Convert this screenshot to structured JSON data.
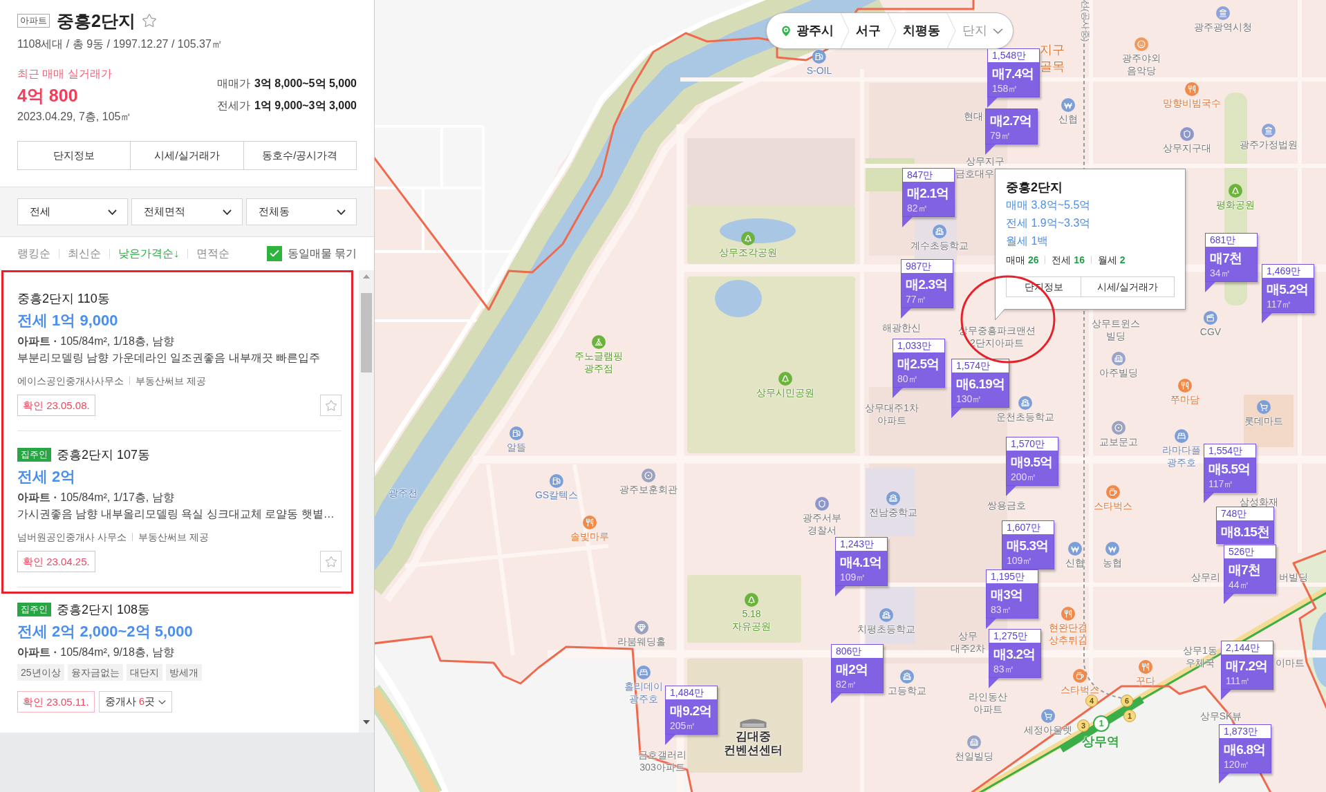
{
  "complex": {
    "type_badge": "아파트",
    "name": "중흥2단지",
    "favorite": false,
    "summary": "1108세대 / 총 9동 / 1997.12.27 / 105.37㎡"
  },
  "recent_trade": {
    "label": "최근 매매 실거래가",
    "price": "4억 800",
    "detail": "2023.04.29, 7층, 105㎡"
  },
  "price_ranges": [
    {
      "label": "매매가",
      "value": "3억 8,000~5억 5,000"
    },
    {
      "label": "전세가",
      "value": "1억 9,000~3억 3,000"
    }
  ],
  "info_tabs": [
    "단지정보",
    "시세/실거래가",
    "동호수/공시가격"
  ],
  "filters": [
    "전세",
    "전체면적",
    "전체동"
  ],
  "sort_options": [
    {
      "label": "랭킹순",
      "selected": false
    },
    {
      "label": "최신순",
      "selected": false
    },
    {
      "label": "낮은가격순↓",
      "selected": true
    },
    {
      "label": "면적순",
      "selected": false
    }
  ],
  "group_same": {
    "label": "동일매물 묶기",
    "checked": true
  },
  "listings": [
    {
      "title": "중흥2단지 110동",
      "price": "전세 1억 9,000",
      "detail": "**아파트 ·** 105/84m², 1/18층, 남향",
      "description": "부분리모델링 남향 가운데라인 일조권좋음 내부깨끗 빠른입주",
      "agency": "에이스공인중개사사무소",
      "provider": "부동산써브 제공",
      "confirmed": "확인 23.05.08.",
      "favorite": false
    },
    {
      "owner_badge": "집주인",
      "title": "중흥2단지 107동",
      "price": "전세 2억",
      "detail": "**아파트 ·** 105/84m², 1/17층, 남향",
      "description": "가시권좋음 남향 내부올리모델링 욕실 싱크대교체 로얄동 햇볕…",
      "agency": "넘버원공인중개사 사무소",
      "provider": "부동산써브 제공",
      "confirmed": "확인 23.04.25.",
      "favorite": false
    },
    {
      "owner_badge": "집주인",
      "title": "중흥2단지 108동",
      "price": "전세 2억 2,000~2억 5,000",
      "detail": "**아파트 ·** 105/84m², 9/18층, 남향",
      "tags": [
        "25년이상",
        "융자금없는",
        "대단지",
        "방세개"
      ],
      "confirmed": "확인 23.05.11.",
      "agents": {
        "label": "중개사",
        "count": "6",
        "unit": "곳"
      }
    }
  ],
  "highlights": [
    {
      "kind": "frame"
    },
    {
      "kind": "circle"
    }
  ],
  "map": {
    "location_bar": [
      {
        "label": "광주시",
        "kind": "location"
      },
      {
        "label": "서구",
        "kind": "area"
      },
      {
        "label": "치평동",
        "kind": "area"
      },
      {
        "label": "단지",
        "kind": "dropdown"
      }
    ],
    "places": [
      {
        "lines": [
          "S-OIL"
        ],
        "kind": "gas"
      },
      {
        "lines": [
          "상무조각공원"
        ],
        "kind": "park"
      },
      {
        "lines": [
          "주노글램핑",
          "광주점"
        ],
        "kind": "camp"
      },
      {
        "lines": [
          "상무시민공원"
        ],
        "kind": "park"
      },
      {
        "lines": [
          "광주광역시청"
        ],
        "kind": "public"
      },
      {
        "lines": [
          "광주야외",
          "음악당"
        ],
        "kind": "culture"
      },
      {
        "lines": [
          "망향비빔국수"
        ],
        "kind": "food"
      },
      {
        "lines": [
          "신협"
        ],
        "kind": "bank"
      },
      {
        "lines": [
          "상무지구대"
        ],
        "kind": "police"
      },
      {
        "lines": [
          "광주가정법원"
        ],
        "kind": "public"
      },
      {
        "lines": [
          "평화공원"
        ],
        "kind": "park"
      },
      {
        "lines": [
          "계수초등학교"
        ],
        "kind": "school"
      },
      {
        "lines": [
          "상무트윈스",
          "빌딩"
        ],
        "kind": "plain"
      },
      {
        "lines": [
          "CGV"
        ],
        "kind": "cinema"
      },
      {
        "lines": [
          "아주빌딩"
        ],
        "kind": "office"
      },
      {
        "lines": [
          "상무중흥파크맨션",
          "2단지아파트"
        ],
        "kind": "plain"
      },
      {
        "lines": [
          "현대"
        ],
        "kind": "plain"
      },
      {
        "lines": [
          "상무지구"
        ],
        "kind": "plain"
      },
      {
        "lines": [
          "해광한신"
        ],
        "kind": "plain"
      },
      {
        "lines": [
          "상무대주1차",
          "아파트"
        ],
        "kind": "plain"
      },
      {
        "lines": [
          "운천초등학교"
        ],
        "kind": "school"
      },
      {
        "lines": [
          "쭈마담"
        ],
        "kind": "food"
      },
      {
        "lines": [
          "롯데마트"
        ],
        "kind": "shop"
      },
      {
        "lines": [
          "교보문고"
        ],
        "kind": "landmark"
      },
      {
        "lines": [
          "전남중학교"
        ],
        "kind": "school"
      },
      {
        "lines": [
          "쌍용금호"
        ],
        "kind": "plain"
      },
      {
        "lines": [
          "스타벅스"
        ],
        "kind": "cafe"
      },
      {
        "lines": [
          "삼성화재"
        ],
        "kind": "plain"
      },
      {
        "lines": [
          "신협"
        ],
        "kind": "bank"
      },
      {
        "lines": [
          "농협"
        ],
        "kind": "bank"
      },
      {
        "lines": [
          "치평초등학교"
        ],
        "kind": "school"
      },
      {
        "lines": [
          "현완단겸",
          "상추튀김"
        ],
        "kind": "food"
      },
      {
        "lines": [
          "이마트"
        ],
        "kind": "plain"
      },
      {
        "lines": [
          "라인동산",
          "아파트"
        ],
        "kind": "plain"
      },
      {
        "lines": [
          "스타벅스"
        ],
        "kind": "cafe"
      },
      {
        "lines": [
          "꾸다"
        ],
        "kind": "food"
      },
      {
        "lines": [
          "세정아울렛"
        ],
        "kind": "shop"
      },
      {
        "lines": [
          "천일빌딩"
        ],
        "kind": "office"
      },
      {
        "lines": [
          "상무SK뷰"
        ],
        "kind": "plain"
      },
      {
        "lines": [
          "알뜰"
        ],
        "kind": "gas"
      },
      {
        "lines": [
          "광주천"
        ],
        "kind": "water"
      },
      {
        "lines": [
          "GS칼텍스"
        ],
        "kind": "gas"
      },
      {
        "lines": [
          "광주보훈회관"
        ],
        "kind": "landmark"
      },
      {
        "lines": [
          "솔빛마루"
        ],
        "kind": "food"
      },
      {
        "lines": [
          "광주서부",
          "경찰서"
        ],
        "kind": "police"
      },
      {
        "lines": [
          "5.18",
          "자유공원"
        ],
        "kind": "park"
      },
      {
        "lines": [
          "라붐웨딩홀"
        ],
        "kind": "wedding"
      },
      {
        "lines": [
          "금호갤러리",
          "303아파트"
        ],
        "kind": "plain"
      },
      {
        "lines": [
          "김대중",
          "컨벤션센터"
        ],
        "kind": "convention"
      },
      {
        "lines": [
          "선(공사중)"
        ],
        "kind": "rail"
      },
      {
        "lines": [
          "지구",
          "골목"
        ],
        "kind": "district"
      },
      {
        "lines": [
          "금호대우"
        ],
        "kind": "plain"
      },
      {
        "lines": [
          "라마다플",
          "광주호"
        ],
        "kind": "hotel"
      },
      {
        "lines": [
          "상무리"
        ],
        "kind": "plain"
      },
      {
        "lines": [
          "버빌딩"
        ],
        "kind": "plain"
      },
      {
        "lines": [
          "상무",
          "대주2차"
        ],
        "kind": "plain"
      },
      {
        "lines": [
          "고등학교"
        ],
        "kind": "school"
      },
      {
        "lines": [
          "상무1동",
          "우체국"
        ],
        "kind": "plain"
      },
      {
        "lines": [
          "홀리데이",
          "광주호"
        ],
        "kind": "hotel"
      }
    ],
    "station": {
      "name": "상무역",
      "line": "1",
      "exits": [
        "4",
        "6",
        "1",
        "3"
      ]
    },
    "markers": [
      {
        "unit_price": "1,548만",
        "price": "매7.4억",
        "area": "158㎡"
      },
      {
        "price": "매2.7억",
        "area": "79㎡"
      },
      {
        "unit_price": "847만",
        "price": "매2.1억",
        "area": "82㎡"
      },
      {
        "unit_price": "987만",
        "price": "매2.3억",
        "area": "77㎡"
      },
      {
        "unit_price": "1,033만",
        "price": "매2.5억",
        "area": "80㎡"
      },
      {
        "unit_price": "1,574만",
        "price": "매6.19억",
        "area": "130㎡"
      },
      {
        "unit_price": "681만",
        "price": "매7천",
        "area": "34㎡"
      },
      {
        "unit_price": "1,469만",
        "price": "매5.2억",
        "area": "117㎡"
      },
      {
        "unit_price": "1,570만",
        "price": "매9.5억",
        "area": "200㎡"
      },
      {
        "unit_price": "1,607만",
        "price": "매5.3억",
        "area": "109㎡"
      },
      {
        "unit_price": "1,195만",
        "price": "매3억",
        "area": "83㎡"
      },
      {
        "unit_price": "1,275만",
        "price": "매3.2억",
        "area": "83㎡"
      },
      {
        "unit_price": "1,554만",
        "price": "매5.5억",
        "area": "117㎡"
      },
      {
        "unit_price": "748만",
        "price": "매8.15천"
      },
      {
        "unit_price": "526만",
        "price": "매7천",
        "area": "44㎡"
      },
      {
        "unit_price": "2,144만",
        "price": "매7.2억",
        "area": "111㎡"
      },
      {
        "unit_price": "1,873만",
        "price": "매6.8억",
        "area": "120㎡"
      },
      {
        "unit_price": "1,243만",
        "price": "매4.1억",
        "area": "109㎡"
      },
      {
        "unit_price": "806만",
        "price": "매2억",
        "area": "82㎡"
      },
      {
        "unit_price": "1,484만",
        "price": "매9.2억",
        "area": "205㎡"
      }
    ],
    "popup": {
      "title": "중흥2단지",
      "ranges": [
        "매매 3.8억~5.5억",
        "전세 1.9억~3.3억",
        "월세 1백"
      ],
      "counts": [
        {
          "label": "매매",
          "value": "26"
        },
        {
          "label": "전세",
          "value": "16"
        },
        {
          "label": "월세",
          "value": "2"
        }
      ],
      "buttons": [
        "단지정보",
        "시세/실거래가"
      ]
    }
  }
}
